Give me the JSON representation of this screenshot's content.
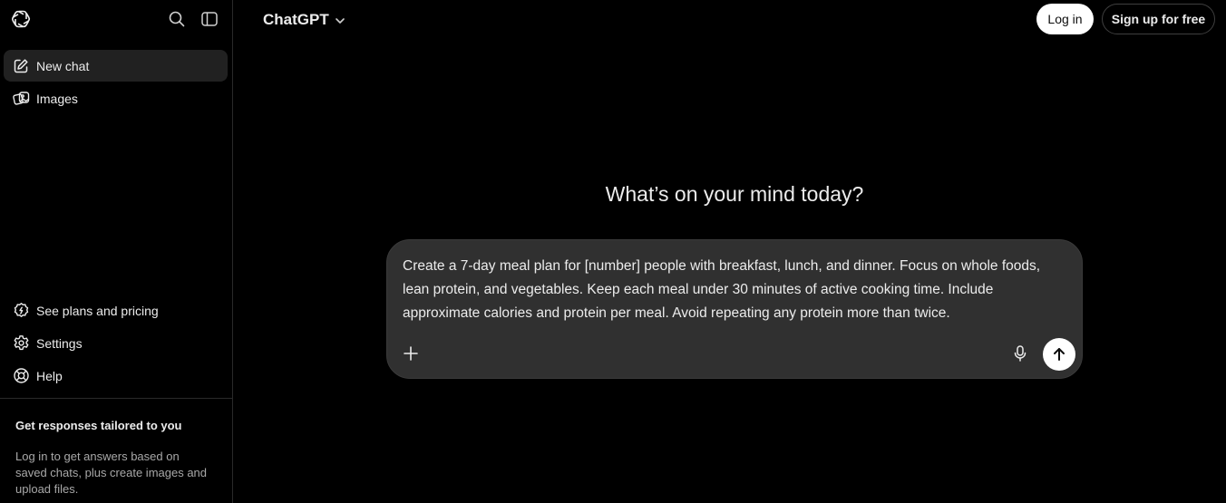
{
  "sidebar": {
    "logo_icon": "openai-logo-icon",
    "search_icon": "search-icon",
    "toggle_icon": "sidebar-toggle-icon",
    "top_items": [
      {
        "label": "New chat",
        "icon": "edit-icon",
        "active": true
      },
      {
        "label": "Images",
        "icon": "images-icon",
        "active": false
      }
    ],
    "bottom_items": [
      {
        "label": "See plans and pricing",
        "icon": "plans-icon"
      },
      {
        "label": "Settings",
        "icon": "gear-icon"
      },
      {
        "label": "Help",
        "icon": "help-icon"
      }
    ],
    "tailored": {
      "title": "Get responses tailored to you",
      "description": "Log in to get answers based on saved chats, plus create images and upload files."
    }
  },
  "header": {
    "model_name": "ChatGPT",
    "model_chevron_icon": "chevron-down-icon",
    "login_label": "Log in",
    "signup_label": "Sign up for free"
  },
  "main": {
    "headline": "What’s on your mind today?",
    "composer": {
      "text": "Create a 7-day meal plan for [number] people with breakfast, lunch, and dinner. Focus on whole foods, lean protein, and vegetables. Keep each meal under 30 minutes of active cooking time. Include approximate calories and protein per meal. Avoid repeating any protein more than twice.",
      "plus_icon": "plus-icon",
      "mic_icon": "microphone-icon",
      "send_icon": "arrow-up-icon"
    }
  },
  "colors": {
    "background": "#000000",
    "sidebar_active": "#212121",
    "composer_bg": "#303030",
    "text_primary": "#ececec",
    "text_secondary": "#a8a8a8",
    "button_white": "#ffffff"
  }
}
